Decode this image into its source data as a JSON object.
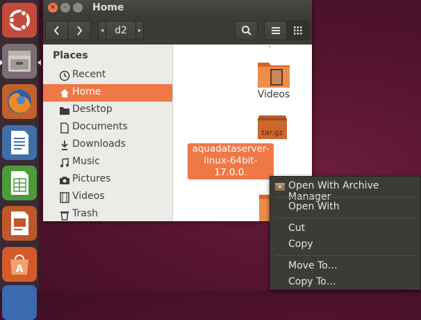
{
  "window": {
    "title": "Home"
  },
  "toolbar": {
    "path_segment": "d2",
    "back_icon": "chevron-left-icon",
    "forward_icon": "chevron-right-icon",
    "search_icon": "search-icon",
    "list_view_icon": "list-icon",
    "grid_view_icon": "grid-icon"
  },
  "sidebar": {
    "heading": "Places",
    "items": [
      {
        "label": "Recent",
        "icon": "clock-icon"
      },
      {
        "label": "Home",
        "icon": "home-icon",
        "selected": true
      },
      {
        "label": "Desktop",
        "icon": "folder-icon"
      },
      {
        "label": "Documents",
        "icon": "document-icon"
      },
      {
        "label": "Downloads",
        "icon": "download-icon"
      },
      {
        "label": "Music",
        "icon": "music-icon"
      },
      {
        "label": "Pictures",
        "icon": "camera-icon"
      },
      {
        "label": "Videos",
        "icon": "film-icon"
      },
      {
        "label": "Trash",
        "icon": "trash-icon"
      }
    ]
  },
  "files": [
    {
      "name": "Videos",
      "type": "videos-folder"
    },
    {
      "name": "aquadataserver-linux-64bit-17.0.0.tar.gz",
      "lines": [
        "aquadataserver-",
        "linux-64bit-17.0.0.",
        "tar.gz"
      ],
      "type": "archive",
      "badge": "tar.gz",
      "selected": true
    },
    {
      "name": "",
      "type": "folder-link"
    }
  ],
  "context_menu": {
    "items": [
      {
        "label": "Open With Archive Manager",
        "icon": "archive-manager-icon"
      },
      {
        "label": "Open With"
      },
      {
        "label": "Cut"
      },
      {
        "label": "Copy"
      },
      {
        "label": "Move To…"
      },
      {
        "label": "Copy To…"
      }
    ]
  },
  "launcher": {
    "items": [
      "ubuntu-dash-icon",
      "files-icon",
      "firefox-icon",
      "writer-icon",
      "calc-icon",
      "impress-icon",
      "software-center-icon"
    ]
  },
  "colors": {
    "accent": "#f07746",
    "menu_bg": "#3c3b37",
    "desktop": "#55142e"
  }
}
